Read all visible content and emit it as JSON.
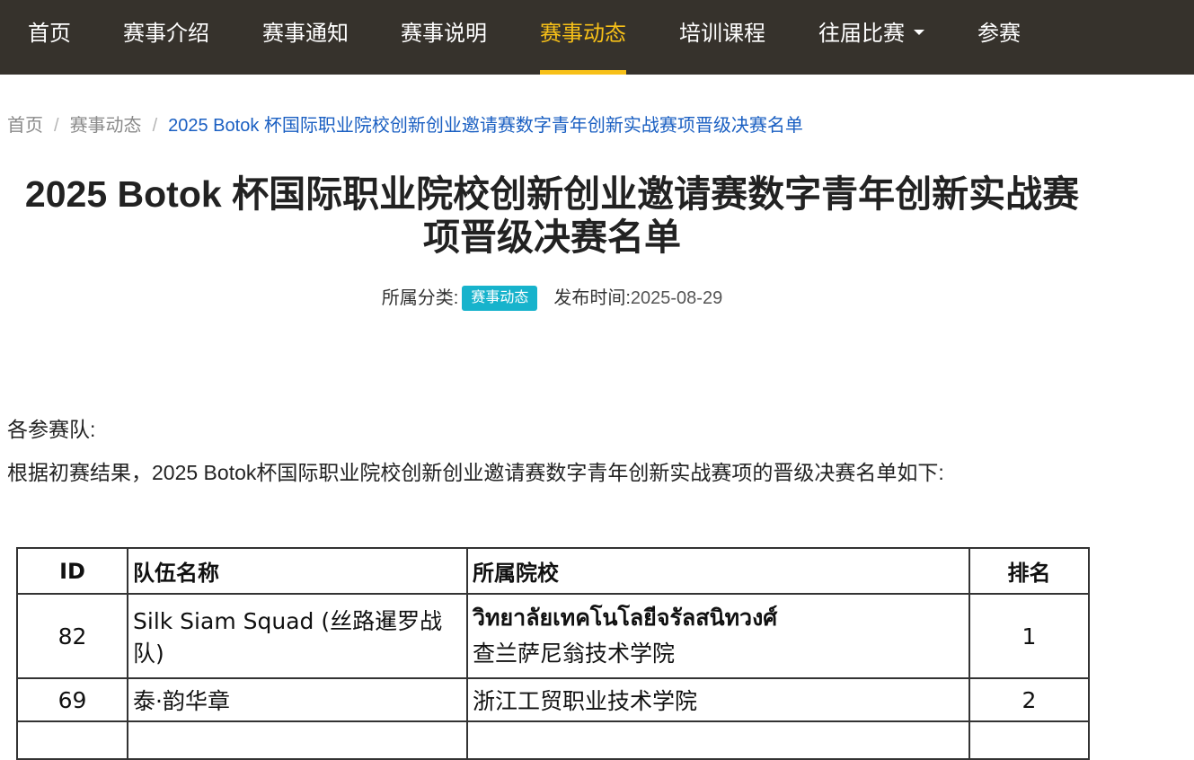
{
  "nav": {
    "items": [
      {
        "label": "首页"
      },
      {
        "label": "赛事介绍"
      },
      {
        "label": "赛事通知"
      },
      {
        "label": "赛事说明"
      },
      {
        "label": "赛事动态",
        "active": true
      },
      {
        "label": "培训课程"
      },
      {
        "label": "往届比赛",
        "dropdown": true
      },
      {
        "label": "参赛"
      }
    ],
    "active_color": "#f7c018",
    "background": "#36322c"
  },
  "breadcrumb": {
    "home": "首页",
    "section": "赛事动态",
    "current": "2025 Botok 杯国际职业院校创新创业邀请赛数字青年创新实战赛项晋级决赛名单"
  },
  "article": {
    "title_line1": "2025 Botok 杯国际职业院校创新创业邀请赛数字青年创新实战赛",
    "title_line2": "项晋级决赛名单",
    "category_label": "所属分类:",
    "category": "赛事动态",
    "category_color": "#17b3cc",
    "date_label": "发布时间:",
    "date": "2025-08-29",
    "greeting": "各参赛队:",
    "intro": "根据初赛结果，2025 Botok杯国际职业院校创新创业邀请赛数字青年创新实战赛项的晋级决赛名单如下:"
  },
  "table": {
    "headers": {
      "id": "ID",
      "team": "队伍名称",
      "school": "所属院校",
      "rank": "排名"
    },
    "rows": [
      {
        "id": "82",
        "team": "Silk Siam Squad (丝路暹罗战队)",
        "school_thai": "วิทยาลัยเทคโนโลยีจรัลสนิทวงศ์",
        "school_cn": "查兰萨尼翁技术学院",
        "rank": "1"
      },
      {
        "id": "69",
        "team": "泰·韵华章",
        "school_thai": "",
        "school_cn": "浙江工贸职业技术学院",
        "rank": "2"
      }
    ]
  }
}
